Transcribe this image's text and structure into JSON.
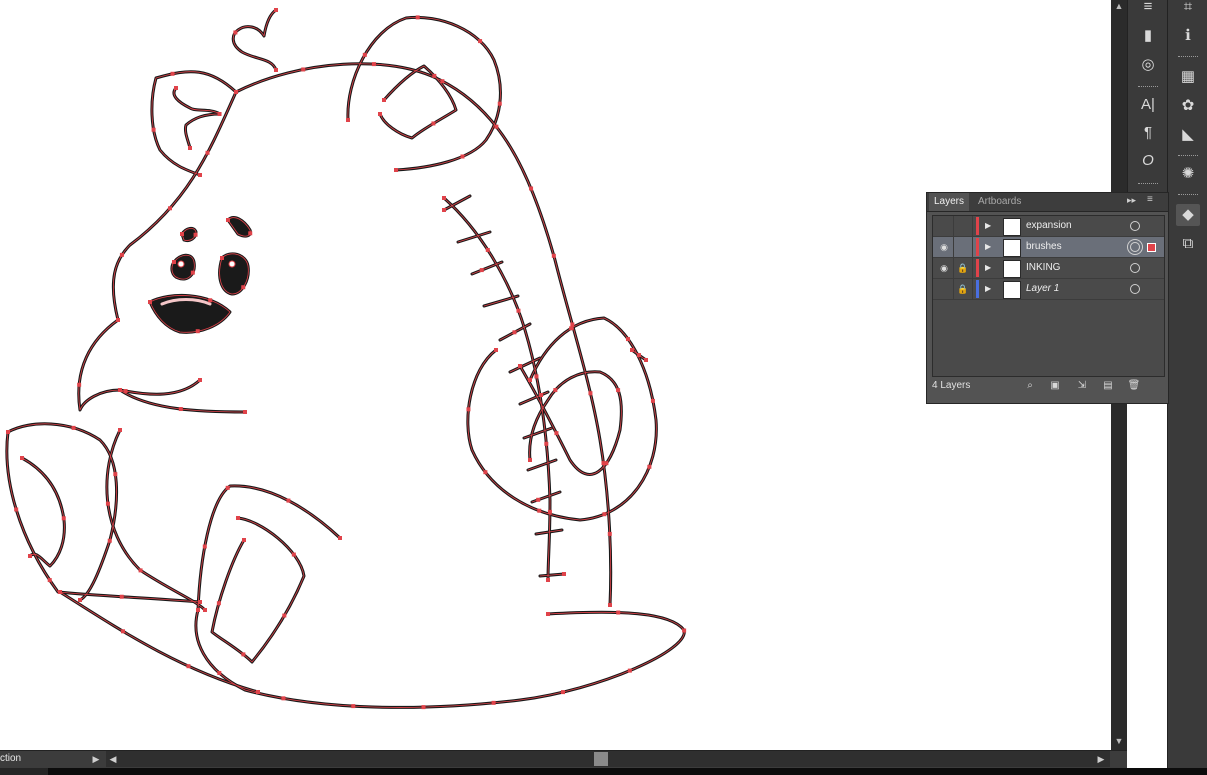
{
  "status_bar": {
    "selection_label": "ction",
    "menu_arrow": "▶"
  },
  "scroll": {
    "left_arrow": "◀",
    "right_arrow": "▶",
    "up_arrow": "▲",
    "down_arrow": "▼"
  },
  "toolbar_strip": {
    "tools": [
      {
        "name": "align-icon",
        "glyph": "≡"
      },
      {
        "name": "gradient-icon",
        "glyph": "▮"
      },
      {
        "name": "transparency-icon",
        "glyph": "◎"
      },
      {
        "name": "character-icon",
        "glyph": "A|"
      },
      {
        "name": "paragraph-icon",
        "glyph": "¶"
      },
      {
        "name": "opentype-icon",
        "glyph": "O"
      }
    ]
  },
  "dock_strip": {
    "tools": [
      {
        "name": "transform-icon",
        "glyph": "⌗"
      },
      {
        "name": "info-icon",
        "glyph": "ℹ"
      },
      {
        "name": "swatches-icon",
        "glyph": "▦"
      },
      {
        "name": "color-guide-icon",
        "glyph": "✿"
      },
      {
        "name": "stroke-icon",
        "glyph": "◣"
      },
      {
        "name": "appearance-icon",
        "glyph": "✺"
      },
      {
        "name": "layers-icon",
        "glyph": "◆"
      },
      {
        "name": "artboards-icon",
        "glyph": "⧉"
      }
    ]
  },
  "layers_panel": {
    "tabs": [
      "Layers",
      "Artboards"
    ],
    "active_tab": "Layers",
    "collapse_glyph": "▸▸",
    "menu_glyph": "≡",
    "layers": [
      {
        "name": "expansion",
        "visible": false,
        "locked": false,
        "color": "#e0434a",
        "selected": false,
        "italic": false
      },
      {
        "name": "brushes",
        "visible": true,
        "locked": false,
        "color": "#e0434a",
        "selected": true,
        "italic": false
      },
      {
        "name": "INKING",
        "visible": true,
        "locked": true,
        "color": "#e0434a",
        "selected": false,
        "italic": false
      },
      {
        "name": "Layer 1",
        "visible": false,
        "locked": true,
        "color": "#4a6fe0",
        "selected": false,
        "italic": true
      }
    ],
    "layer_count": "4 Layers",
    "footer_icons": [
      "locate-object-icon",
      "make-clipping-mask-icon",
      "create-sublayer-icon",
      "create-new-layer-icon",
      "delete-layer-icon"
    ],
    "footer_glyphs": [
      "⌕",
      "▣",
      "⇲",
      "▤",
      "🗑"
    ]
  },
  "icons": {
    "eye": "◉",
    "lock": "🔒",
    "expand": "▶"
  },
  "colors": {
    "path_color": "#e0434a",
    "ink": "#1a1a1a"
  }
}
